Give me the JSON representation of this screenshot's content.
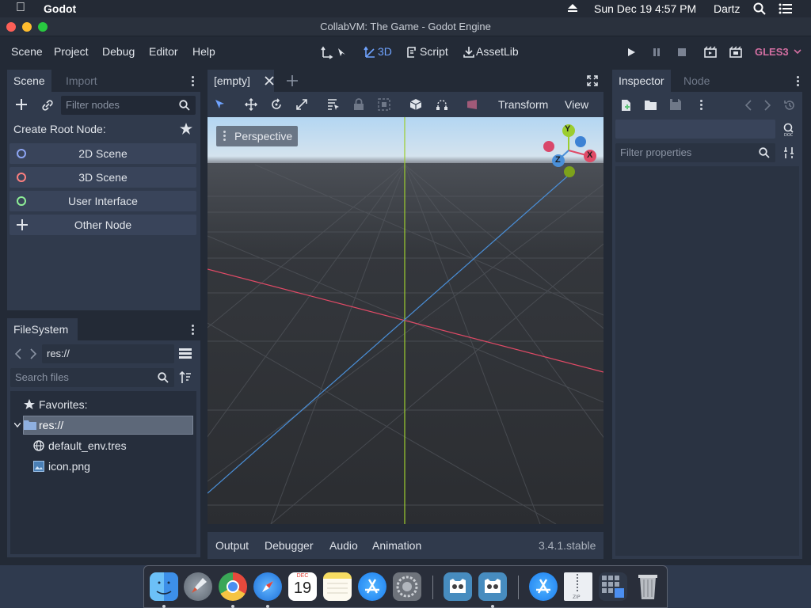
{
  "menubar": {
    "app_name": "Godot",
    "datetime": "Sun Dec 19  4:57 PM",
    "user": "Dartz"
  },
  "window": {
    "title": "CollabVM: The Game - Godot Engine"
  },
  "main_menu": {
    "items": [
      "Scene",
      "Project",
      "Debug",
      "Editor",
      "Help"
    ],
    "workspaces": {
      "view3d": "3D",
      "script": "Script",
      "assetlib": "AssetLib"
    },
    "renderer": "GLES3"
  },
  "scene_dock": {
    "tabs": [
      "Scene",
      "Import"
    ],
    "filter_placeholder": "Filter nodes",
    "create_root_label": "Create Root Node:",
    "root_buttons": [
      "2D Scene",
      "3D Scene",
      "User Interface",
      "Other Node"
    ],
    "ring_colors": [
      "#8da5f3",
      "#fc7f7f",
      "#8eef97"
    ]
  },
  "filesystem_dock": {
    "tab": "FileSystem",
    "path": "res://",
    "search_placeholder": "Search files",
    "favorites_label": "Favorites:",
    "root_label": "res://",
    "files": [
      "default_env.tres",
      "icon.png"
    ]
  },
  "editor": {
    "scene_tab": "[empty]",
    "toolbar": {
      "transform": "Transform",
      "view": "View"
    },
    "viewport_menu": "Perspective",
    "gizmo": {
      "x": "X",
      "y": "Y",
      "z": "Z"
    },
    "bottom_tabs": [
      "Output",
      "Debugger",
      "Audio",
      "Animation"
    ],
    "version": "3.4.1.stable"
  },
  "inspector_dock": {
    "tabs": [
      "Inspector",
      "Node"
    ],
    "filter_placeholder": "Filter properties"
  },
  "dock_apps": [
    {
      "name": "finder-icon",
      "color": "#3d8fe8"
    },
    {
      "name": "launchpad-icon",
      "color": "#7d8793"
    },
    {
      "name": "chrome-icon",
      "color": "#e8e8e8"
    },
    {
      "name": "safari-icon",
      "color": "#2f8cf0"
    },
    {
      "name": "calendar-icon",
      "color": "#ffffff"
    },
    {
      "name": "notes-icon",
      "color": "#f5e07a"
    },
    {
      "name": "app-store-icon",
      "color": "#1c8ef9"
    },
    {
      "name": "system-preferences-icon",
      "color": "#8c8f95"
    },
    {
      "name": "godot-icon",
      "color": "#478cbf"
    },
    {
      "name": "godot-icon-2",
      "color": "#478cbf"
    },
    {
      "name": "app-store-folder-icon",
      "color": "#1c8ef9"
    },
    {
      "name": "archive-icon",
      "color": "#e6e6e6"
    },
    {
      "name": "window-grid-icon",
      "color": "#3b4658"
    },
    {
      "name": "trash-icon",
      "color": "#b9bdc3"
    }
  ],
  "calendar_icon": {
    "month": "DEC",
    "day": "19"
  }
}
